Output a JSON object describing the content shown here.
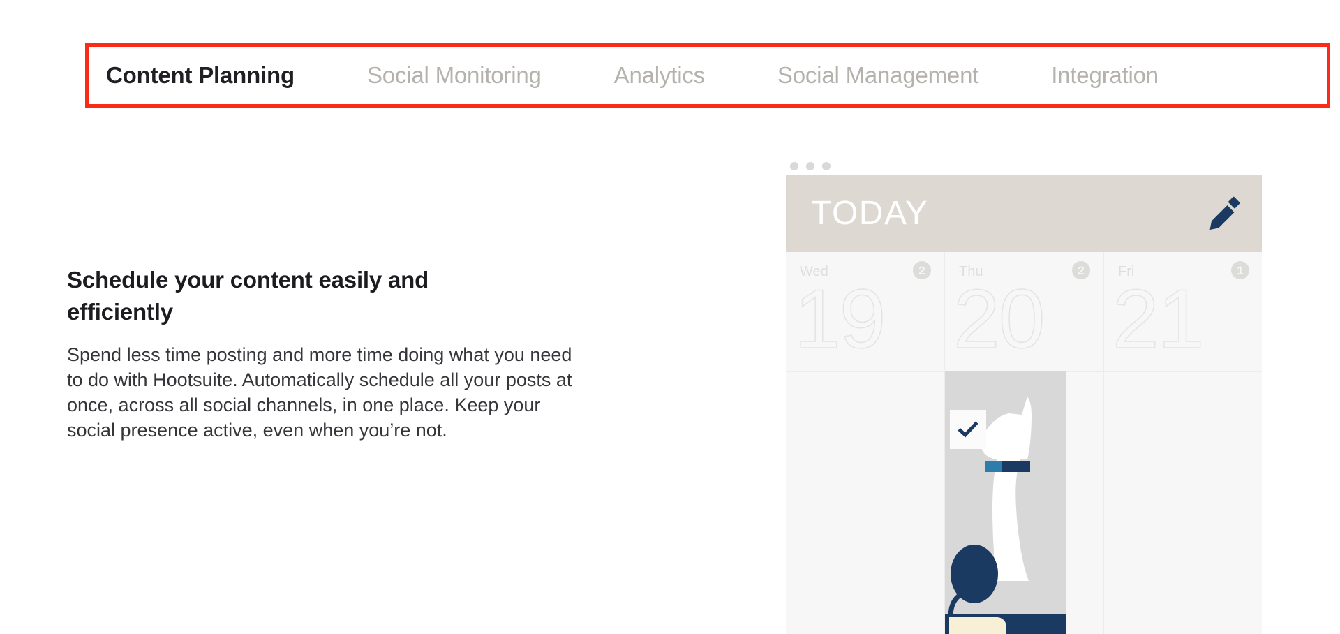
{
  "theme": {
    "page_background": "#ffffff",
    "annotation_color": "#fb2b1a",
    "active_tab_color": "#202024",
    "inactive_tab_color": "#b5b2ae",
    "heading_color": "#1c1c20",
    "body_color": "#35353a",
    "calendar_header_background": "#ddd8d1",
    "calendar_body_background": "#f7f7f7",
    "accent_navy": "#1b3a61",
    "collar_light_blue": "#2e7cab",
    "book_cream": "#f7efd6",
    "illustration_background": "#d8d8d8"
  },
  "tabs": [
    {
      "label": "Content Planning",
      "active": true,
      "name": "tab-content-planning"
    },
    {
      "label": "Social Monitoring",
      "active": false,
      "name": "tab-social-monitoring"
    },
    {
      "label": "Analytics",
      "active": false,
      "name": "tab-analytics"
    },
    {
      "label": "Social Management",
      "active": false,
      "name": "tab-social-management"
    },
    {
      "label": "Integration",
      "active": false,
      "name": "tab-integration"
    }
  ],
  "feature": {
    "heading": "Schedule your content easily and efficiently",
    "body": "Spend less time posting and more time doing what you need to do with Hootsuite. Automatically schedule all your posts at once, across all social channels, in one place. Keep your social presence active, even when you’re not."
  },
  "calendar_widget": {
    "window_dots": 3,
    "header_title": "TODAY",
    "edit_icon": "pencil-icon",
    "status_icon": "check-icon",
    "days": [
      {
        "weekday": "Wed",
        "date": "19",
        "badge": "2"
      },
      {
        "weekday": "Thu",
        "date": "20",
        "badge": "2"
      },
      {
        "weekday": "Fri",
        "date": "21",
        "badge": "1"
      }
    ],
    "illustration": "person-reading-with-cat"
  }
}
